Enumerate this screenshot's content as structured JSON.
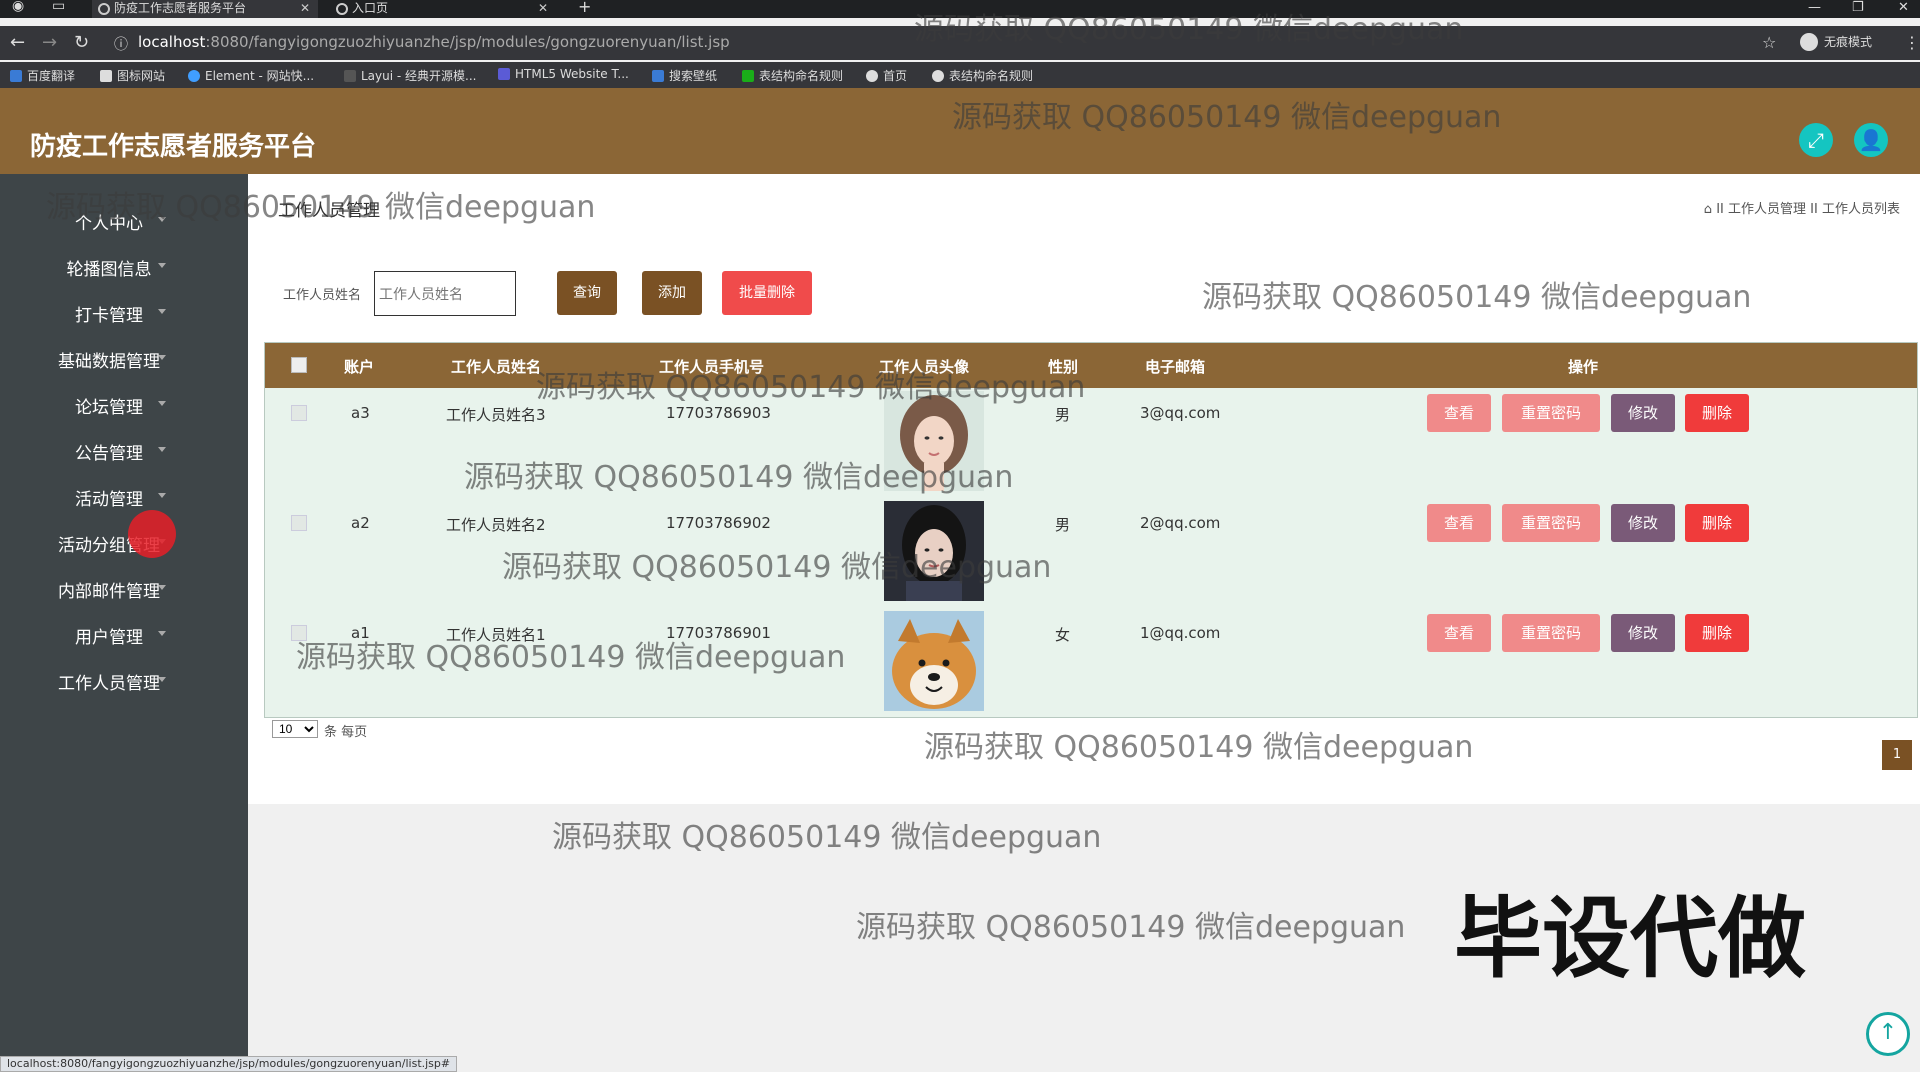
{
  "browser": {
    "tabs": [
      {
        "label": "防疫工作志愿者服务平台",
        "active": true
      },
      {
        "label": "入口页",
        "active": false
      }
    ],
    "new_tab": "+",
    "url_host": "localhost",
    "url_path": ":8080/fangyigongzuozhiyuanzhe/jsp/modules/gongzuorenyuan/list.jsp",
    "incognito_label": "无痕模式",
    "bookmarks": [
      {
        "label": "百度翻译",
        "color": "#3a7bd5"
      },
      {
        "label": "图标网站",
        "color": "#dddddd"
      },
      {
        "label": "Element - 网站快...",
        "color": "#409eff"
      },
      {
        "label": "Layui - 经典开源模...",
        "color": "#555555"
      },
      {
        "label": "HTML5 Website T...",
        "color": "#5b5bd6"
      },
      {
        "label": "搜索壁纸",
        "color": "#3a7bd5"
      },
      {
        "label": "表结构命名规则",
        "color": "#1aad19"
      },
      {
        "label": "首页",
        "color": "#dddddd"
      },
      {
        "label": "表结构命名规则",
        "color": "#dddddd"
      }
    ]
  },
  "header": {
    "title": "防疫工作志愿者服务平台",
    "accent": "#8b6636",
    "icon_color": "#14c5c1"
  },
  "sidebar": {
    "items": [
      {
        "label": "个人中心"
      },
      {
        "label": "轮播图信息"
      },
      {
        "label": "打卡管理"
      },
      {
        "label": "基础数据管理"
      },
      {
        "label": "论坛管理"
      },
      {
        "label": "公告管理"
      },
      {
        "label": "活动管理"
      },
      {
        "label": "活动分组管理"
      },
      {
        "label": "内部邮件管理"
      },
      {
        "label": "用户管理"
      },
      {
        "label": "工作人员管理"
      }
    ]
  },
  "main": {
    "page_title": "工作人员管理",
    "breadcrumb": [
      "工作人员管理",
      "工作人员列表"
    ],
    "breadcrumb_sep": "II",
    "filter": {
      "label": "工作人员姓名",
      "placeholder": "工作人员姓名"
    },
    "buttons": {
      "search": "查询",
      "add": "添加",
      "batch_delete": "批量删除"
    },
    "table": {
      "columns": [
        "账户",
        "工作人员姓名",
        "工作人员手机号",
        "工作人员头像",
        "性别",
        "电子邮箱",
        "操作"
      ],
      "rows": [
        {
          "account": "a3",
          "name": "工作人员姓名3",
          "phone": "17703786903",
          "gender": "男",
          "email": "3@qq.com",
          "avatar": "woman-portrait"
        },
        {
          "account": "a2",
          "name": "工作人员姓名2",
          "phone": "17703786902",
          "gender": "男",
          "email": "2@qq.com",
          "avatar": "woman-dark-portrait"
        },
        {
          "account": "a1",
          "name": "工作人员姓名1",
          "phone": "17703786901",
          "gender": "女",
          "email": "1@qq.com",
          "avatar": "shiba-dog"
        }
      ],
      "row_actions": [
        "查看",
        "重置密码",
        "修改",
        "删除"
      ]
    },
    "pagination": {
      "page_size": "10",
      "page_size_suffix": "条 每页",
      "current_page": "1"
    }
  },
  "watermark_text": "源码获取 QQ86050149 微信deepguan",
  "promo_text": "毕设代做",
  "status_url": "localhost:8080/fangyigongzuozhiyuanzhe/jsp/modules/gongzuorenyuan/list.jsp#"
}
